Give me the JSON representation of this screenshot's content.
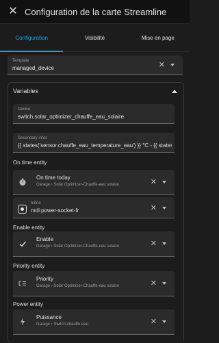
{
  "header": {
    "title": "Configuration de la carte Streamline"
  },
  "tabs": [
    {
      "label": "Configuration"
    },
    {
      "label": "Visibilité"
    },
    {
      "label": "Mise en page"
    }
  ],
  "template": {
    "label": "Template",
    "value": "managed_device"
  },
  "variables": {
    "title": "Variables",
    "device": {
      "label": "Device",
      "value": "switch.solar_optimizer_chauffe_eau_solaire"
    },
    "secondary": {
      "label": "Secondary infos",
      "value": "{{ states('sensor.chauffe_eau_temperature_eau') }} °C - {{ states('sen"
    },
    "on_time": {
      "section": "On time entity",
      "name": "On time today",
      "sub": "Garage › Solar Optimizer-Chauffe-eau solaire",
      "icon_label": "Icône",
      "icon_value": "mdi:power-socket-fr"
    },
    "enable": {
      "section": "Enable entity",
      "name": "Enable",
      "sub": "Garage › Solar Optimizer-Chauffe-eau solaire"
    },
    "priority": {
      "section": "Priority entity",
      "name": "Priority",
      "sub": "Garage › Solar Optimizer-Chauffe-eau solaire"
    },
    "power": {
      "section": "Power entity",
      "name": "Puissance",
      "sub": "Garage › Switch chauffe eau"
    }
  },
  "icons": {
    "close": "close-icon",
    "clear": "clear-icon",
    "dropdown": "chevron-down-icon",
    "collapse": "chevron-up-icon",
    "timer": "timer-icon",
    "socket": "power-socket-icon",
    "check": "check-icon",
    "priority": "priority-icon",
    "bolt": "bolt-icon"
  },
  "colors": {
    "accent": "#03a9f4",
    "background": "#1c1c1c"
  }
}
